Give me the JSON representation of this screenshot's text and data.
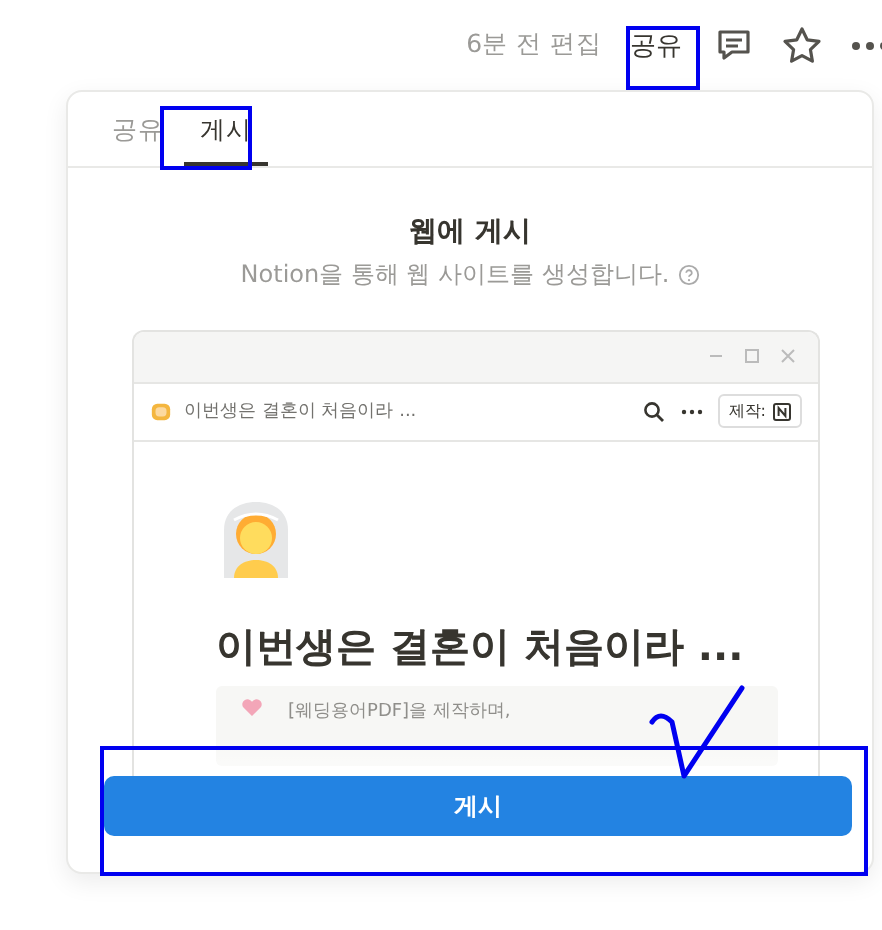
{
  "header": {
    "edited": "6분 전 편집",
    "share": "공유"
  },
  "popup": {
    "tabs": [
      {
        "label": "공유",
        "selected": false
      },
      {
        "label": "게시",
        "selected": true
      }
    ],
    "title": "웹에 게시",
    "subtitle": "Notion을 통해 웹 사이트를 생성합니다.",
    "preview": {
      "page_title": "이번생은 결혼이 처음이라 ...",
      "made_with": "제작:",
      "heading": "이번생은 결혼이 처음이라 ...",
      "callout": "[웨딩용어PDF]을 제작하며,"
    },
    "button": "게시"
  }
}
